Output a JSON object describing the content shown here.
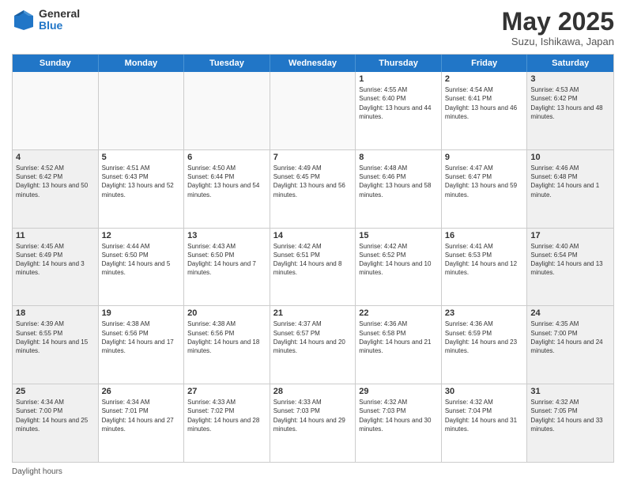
{
  "logo": {
    "general": "General",
    "blue": "Blue"
  },
  "header": {
    "month": "May 2025",
    "location": "Suzu, Ishikawa, Japan"
  },
  "weekdays": [
    "Sunday",
    "Monday",
    "Tuesday",
    "Wednesday",
    "Thursday",
    "Friday",
    "Saturday"
  ],
  "rows": [
    [
      {
        "day": "",
        "text": ""
      },
      {
        "day": "",
        "text": ""
      },
      {
        "day": "",
        "text": ""
      },
      {
        "day": "",
        "text": ""
      },
      {
        "day": "1",
        "text": "Sunrise: 4:55 AM\nSunset: 6:40 PM\nDaylight: 13 hours and 44 minutes."
      },
      {
        "day": "2",
        "text": "Sunrise: 4:54 AM\nSunset: 6:41 PM\nDaylight: 13 hours and 46 minutes."
      },
      {
        "day": "3",
        "text": "Sunrise: 4:53 AM\nSunset: 6:42 PM\nDaylight: 13 hours and 48 minutes."
      }
    ],
    [
      {
        "day": "4",
        "text": "Sunrise: 4:52 AM\nSunset: 6:42 PM\nDaylight: 13 hours and 50 minutes."
      },
      {
        "day": "5",
        "text": "Sunrise: 4:51 AM\nSunset: 6:43 PM\nDaylight: 13 hours and 52 minutes."
      },
      {
        "day": "6",
        "text": "Sunrise: 4:50 AM\nSunset: 6:44 PM\nDaylight: 13 hours and 54 minutes."
      },
      {
        "day": "7",
        "text": "Sunrise: 4:49 AM\nSunset: 6:45 PM\nDaylight: 13 hours and 56 minutes."
      },
      {
        "day": "8",
        "text": "Sunrise: 4:48 AM\nSunset: 6:46 PM\nDaylight: 13 hours and 58 minutes."
      },
      {
        "day": "9",
        "text": "Sunrise: 4:47 AM\nSunset: 6:47 PM\nDaylight: 13 hours and 59 minutes."
      },
      {
        "day": "10",
        "text": "Sunrise: 4:46 AM\nSunset: 6:48 PM\nDaylight: 14 hours and 1 minute."
      }
    ],
    [
      {
        "day": "11",
        "text": "Sunrise: 4:45 AM\nSunset: 6:49 PM\nDaylight: 14 hours and 3 minutes."
      },
      {
        "day": "12",
        "text": "Sunrise: 4:44 AM\nSunset: 6:50 PM\nDaylight: 14 hours and 5 minutes."
      },
      {
        "day": "13",
        "text": "Sunrise: 4:43 AM\nSunset: 6:50 PM\nDaylight: 14 hours and 7 minutes."
      },
      {
        "day": "14",
        "text": "Sunrise: 4:42 AM\nSunset: 6:51 PM\nDaylight: 14 hours and 8 minutes."
      },
      {
        "day": "15",
        "text": "Sunrise: 4:42 AM\nSunset: 6:52 PM\nDaylight: 14 hours and 10 minutes."
      },
      {
        "day": "16",
        "text": "Sunrise: 4:41 AM\nSunset: 6:53 PM\nDaylight: 14 hours and 12 minutes."
      },
      {
        "day": "17",
        "text": "Sunrise: 4:40 AM\nSunset: 6:54 PM\nDaylight: 14 hours and 13 minutes."
      }
    ],
    [
      {
        "day": "18",
        "text": "Sunrise: 4:39 AM\nSunset: 6:55 PM\nDaylight: 14 hours and 15 minutes."
      },
      {
        "day": "19",
        "text": "Sunrise: 4:38 AM\nSunset: 6:56 PM\nDaylight: 14 hours and 17 minutes."
      },
      {
        "day": "20",
        "text": "Sunrise: 4:38 AM\nSunset: 6:56 PM\nDaylight: 14 hours and 18 minutes."
      },
      {
        "day": "21",
        "text": "Sunrise: 4:37 AM\nSunset: 6:57 PM\nDaylight: 14 hours and 20 minutes."
      },
      {
        "day": "22",
        "text": "Sunrise: 4:36 AM\nSunset: 6:58 PM\nDaylight: 14 hours and 21 minutes."
      },
      {
        "day": "23",
        "text": "Sunrise: 4:36 AM\nSunset: 6:59 PM\nDaylight: 14 hours and 23 minutes."
      },
      {
        "day": "24",
        "text": "Sunrise: 4:35 AM\nSunset: 7:00 PM\nDaylight: 14 hours and 24 minutes."
      }
    ],
    [
      {
        "day": "25",
        "text": "Sunrise: 4:34 AM\nSunset: 7:00 PM\nDaylight: 14 hours and 25 minutes."
      },
      {
        "day": "26",
        "text": "Sunrise: 4:34 AM\nSunset: 7:01 PM\nDaylight: 14 hours and 27 minutes."
      },
      {
        "day": "27",
        "text": "Sunrise: 4:33 AM\nSunset: 7:02 PM\nDaylight: 14 hours and 28 minutes."
      },
      {
        "day": "28",
        "text": "Sunrise: 4:33 AM\nSunset: 7:03 PM\nDaylight: 14 hours and 29 minutes."
      },
      {
        "day": "29",
        "text": "Sunrise: 4:32 AM\nSunset: 7:03 PM\nDaylight: 14 hours and 30 minutes."
      },
      {
        "day": "30",
        "text": "Sunrise: 4:32 AM\nSunset: 7:04 PM\nDaylight: 14 hours and 31 minutes."
      },
      {
        "day": "31",
        "text": "Sunrise: 4:32 AM\nSunset: 7:05 PM\nDaylight: 14 hours and 33 minutes."
      }
    ]
  ],
  "footer": {
    "daylight_label": "Daylight hours"
  }
}
